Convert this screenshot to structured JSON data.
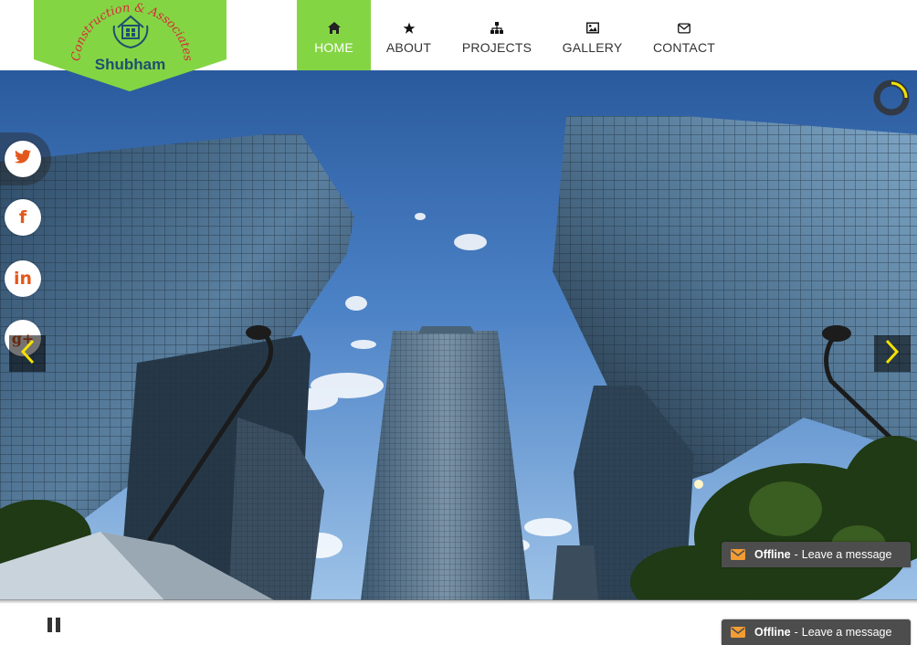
{
  "brand": {
    "name": "Shubham",
    "arc_text": "Construction & Associates",
    "accent_color": "#84d543",
    "name_color": "#1d4f70",
    "arc_color": "#d62b3b"
  },
  "nav": {
    "items": [
      {
        "label": "HOME",
        "icon": "home-icon",
        "active": true
      },
      {
        "label": "ABOUT",
        "icon": "star-icon",
        "active": false
      },
      {
        "label": "PROJECTS",
        "icon": "sitemap-icon",
        "active": false
      },
      {
        "label": "GALLERY",
        "icon": "picture-icon",
        "active": false
      },
      {
        "label": "CONTACT",
        "icon": "envelope-icon",
        "active": false
      }
    ]
  },
  "social": {
    "items": [
      {
        "name": "twitter",
        "icon": "twitter-icon"
      },
      {
        "name": "facebook",
        "icon": "facebook-icon",
        "glyph": "f"
      },
      {
        "name": "linkedin",
        "icon": "linkedin-icon",
        "glyph": "in"
      },
      {
        "name": "google-plus",
        "icon": "google-plus-icon",
        "glyph": "g+"
      }
    ],
    "icon_color": "#e4571c"
  },
  "slider": {
    "image": "skyscrapers-photo",
    "prev_icon": "chevron-left-icon",
    "next_icon": "chevron-right-icon",
    "timer_icon": "loading-ring-icon",
    "pause_icon": "pause-icon"
  },
  "chat": {
    "status": "Offline",
    "separator": "-",
    "message": "Leave a message",
    "icon": "envelope-icon"
  }
}
